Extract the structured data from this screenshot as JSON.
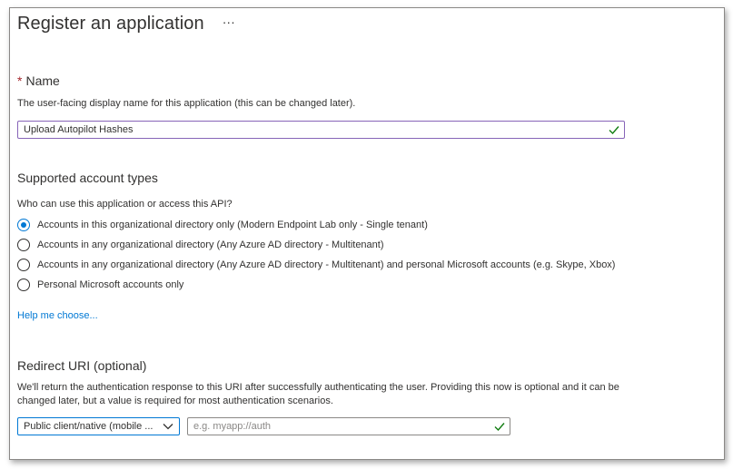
{
  "page": {
    "title": "Register an application",
    "more_label": "···"
  },
  "name_section": {
    "required_mark": "*",
    "heading": "Name",
    "description": "The user-facing display name for this application (this can be changed later).",
    "value": "Upload Autopilot Hashes"
  },
  "account_types": {
    "heading": "Supported account types",
    "question": "Who can use this application or access this API?",
    "options": [
      {
        "label": "Accounts in this organizational directory only (Modern Endpoint Lab only - Single tenant)",
        "selected": true
      },
      {
        "label": "Accounts in any organizational directory (Any Azure AD directory - Multitenant)",
        "selected": false
      },
      {
        "label": "Accounts in any organizational directory (Any Azure AD directory - Multitenant) and personal Microsoft accounts (e.g. Skype, Xbox)",
        "selected": false
      },
      {
        "label": "Personal Microsoft accounts only",
        "selected": false
      }
    ],
    "help_link": "Help me choose..."
  },
  "redirect": {
    "heading": "Redirect URI (optional)",
    "description_line1": "We'll return the authentication response to this URI after successfully authenticating the user. Providing this now is optional and it can be",
    "description_line2": "changed later, but a value is required for most authentication scenarios.",
    "platform_value": "Public client/native (mobile ...",
    "uri_value": "",
    "uri_placeholder": "e.g. myapp://auth"
  },
  "colors": {
    "accent": "#0078d4",
    "valid_check": "#107c10",
    "focus_border": "#8764b8",
    "required": "#a4262c"
  }
}
